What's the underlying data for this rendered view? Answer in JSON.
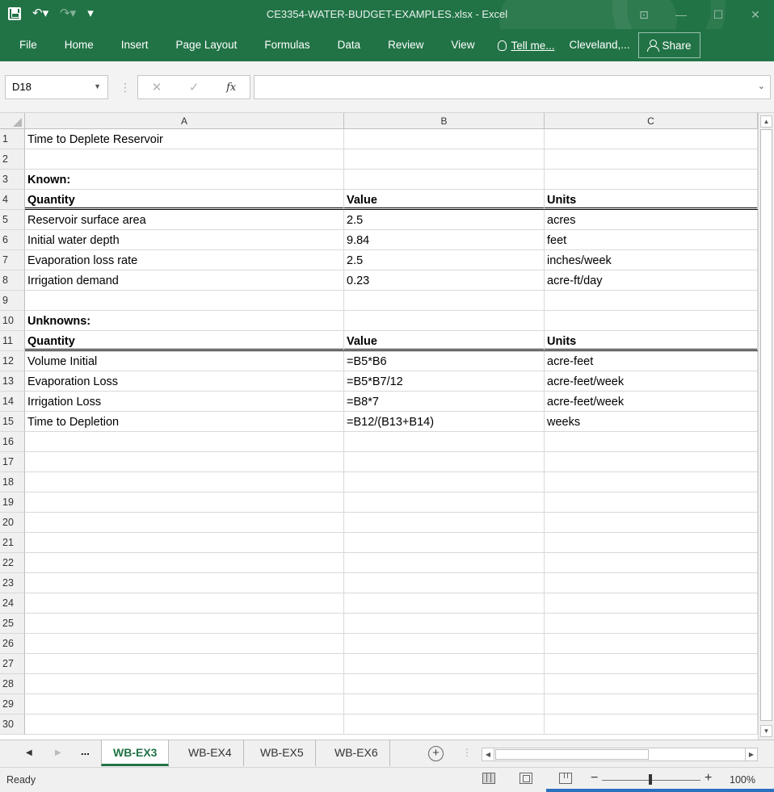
{
  "window": {
    "title": "CE3354-WATER-BUDGET-EXAMPLES.xlsx - Excel",
    "accent": "#217346"
  },
  "ribbon": {
    "tabs": [
      "File",
      "Home",
      "Insert",
      "Page Layout",
      "Formulas",
      "Data",
      "Review",
      "View"
    ],
    "tell_me": "Tell me...",
    "account": "Cleveland,...",
    "share": "Share"
  },
  "formula_bar": {
    "name_box": "D18",
    "formula": ""
  },
  "columns": [
    "A",
    "B",
    "C"
  ],
  "rows": [
    {
      "n": "1",
      "a": "Time to Deplete Reservoir",
      "b": "",
      "c": "",
      "bold": false,
      "dbl": false
    },
    {
      "n": "2",
      "a": "",
      "b": "",
      "c": "",
      "bold": false,
      "dbl": false
    },
    {
      "n": "3",
      "a": "Known:",
      "b": "",
      "c": "",
      "bold": true,
      "dbl": false
    },
    {
      "n": "4",
      "a": "Quantity",
      "b": "Value",
      "c": "Units",
      "bold": true,
      "dbl": true
    },
    {
      "n": "5",
      "a": "Reservoir surface area",
      "b": "2.5",
      "c": "acres",
      "bold": false,
      "dbl": false
    },
    {
      "n": "6",
      "a": "Initial water depth",
      "b": "9.84",
      "c": "feet",
      "bold": false,
      "dbl": false
    },
    {
      "n": "7",
      "a": "Evaporation loss rate",
      "b": "2.5",
      "c": "inches/week",
      "bold": false,
      "dbl": false
    },
    {
      "n": "8",
      "a": "Irrigation demand",
      "b": "0.23",
      "c": "acre-ft/day",
      "bold": false,
      "dbl": false
    },
    {
      "n": "9",
      "a": "",
      "b": "",
      "c": "",
      "bold": false,
      "dbl": false
    },
    {
      "n": "10",
      "a": "Unknowns:",
      "b": "",
      "c": "",
      "bold": true,
      "dbl": false
    },
    {
      "n": "11",
      "a": "Quantity",
      "b": "Value",
      "c": "Units",
      "bold": true,
      "dbl": true
    },
    {
      "n": "12",
      "a": "Volume Initial",
      "b": "=B5*B6",
      "c": "acre-feet",
      "bold": false,
      "dbl": false
    },
    {
      "n": "13",
      "a": "Evaporation Loss",
      "b": "=B5*B7/12",
      "c": "acre-feet/week",
      "bold": false,
      "dbl": false
    },
    {
      "n": "14",
      "a": "Irrigation Loss",
      "b": "=B8*7",
      "c": "acre-feet/week",
      "bold": false,
      "dbl": false
    },
    {
      "n": "15",
      "a": "Time to Depletion",
      "b": "=B12/(B13+B14)",
      "c": "weeks",
      "bold": false,
      "dbl": false
    },
    {
      "n": "16",
      "a": "",
      "b": "",
      "c": "",
      "bold": false,
      "dbl": false
    },
    {
      "n": "17",
      "a": "",
      "b": "",
      "c": "",
      "bold": false,
      "dbl": false
    },
    {
      "n": "18",
      "a": "",
      "b": "",
      "c": "",
      "bold": false,
      "dbl": false
    },
    {
      "n": "19",
      "a": "",
      "b": "",
      "c": "",
      "bold": false,
      "dbl": false
    },
    {
      "n": "20",
      "a": "",
      "b": "",
      "c": "",
      "bold": false,
      "dbl": false
    },
    {
      "n": "21",
      "a": "",
      "b": "",
      "c": "",
      "bold": false,
      "dbl": false
    },
    {
      "n": "22",
      "a": "",
      "b": "",
      "c": "",
      "bold": false,
      "dbl": false
    },
    {
      "n": "23",
      "a": "",
      "b": "",
      "c": "",
      "bold": false,
      "dbl": false
    },
    {
      "n": "24",
      "a": "",
      "b": "",
      "c": "",
      "bold": false,
      "dbl": false
    },
    {
      "n": "25",
      "a": "",
      "b": "",
      "c": "",
      "bold": false,
      "dbl": false
    },
    {
      "n": "26",
      "a": "",
      "b": "",
      "c": "",
      "bold": false,
      "dbl": false
    },
    {
      "n": "27",
      "a": "",
      "b": "",
      "c": "",
      "bold": false,
      "dbl": false
    },
    {
      "n": "28",
      "a": "",
      "b": "",
      "c": "",
      "bold": false,
      "dbl": false
    },
    {
      "n": "29",
      "a": "",
      "b": "",
      "c": "",
      "bold": false,
      "dbl": false
    },
    {
      "n": "30",
      "a": "",
      "b": "",
      "c": "",
      "bold": false,
      "dbl": false
    }
  ],
  "sheets": {
    "overflow": "...",
    "tabs": [
      "WB-EX3",
      "WB-EX4",
      "WB-EX5",
      "WB-EX6"
    ],
    "active": "WB-EX3"
  },
  "status": {
    "ready": "Ready",
    "zoom": "100%"
  },
  "icons": {
    "save": "save-icon",
    "undo": "undo-icon",
    "redo": "redo-icon",
    "customize": "customize-qat-icon",
    "tell_me": "lightbulb-icon",
    "share": "person-icon",
    "cancel": "cancel-icon",
    "enter": "checkmark-icon",
    "function": "fx-icon",
    "add_sheet": "plus-circle-icon"
  }
}
